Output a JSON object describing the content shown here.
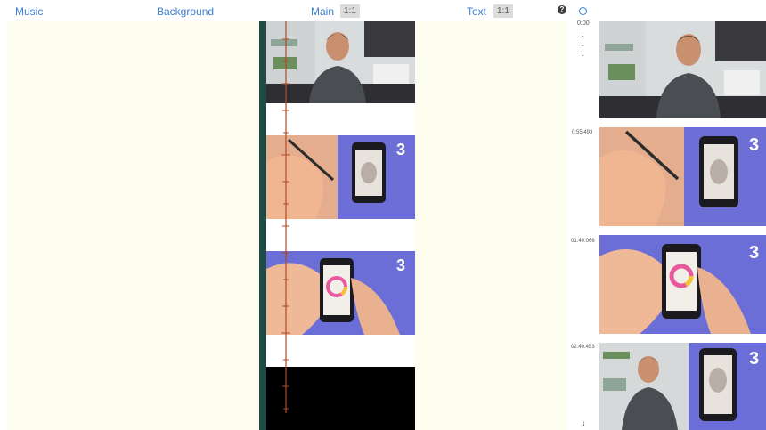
{
  "header": {
    "music_label": "Music",
    "background_label": "Background",
    "main_label": "Main",
    "main_ratio": "1:1",
    "text_label": "Text",
    "text_ratio": "1:1",
    "help_glyph": "?"
  },
  "timeline": {
    "start_time": "0:00",
    "markers": [
      {
        "time": "0:55.493"
      },
      {
        "time": "01:40.066"
      },
      {
        "time": "02:40.453"
      }
    ]
  },
  "icons": [
    "help-icon",
    "clock-icon",
    "down-arrow-icon"
  ],
  "colors": {
    "header_link": "#3a7fd1",
    "column_bg": "#fdfdf0",
    "waveform": "#b04a2a",
    "purple_bg": "#6b6ed6",
    "dark_teal_bar": "#1f4a45"
  }
}
